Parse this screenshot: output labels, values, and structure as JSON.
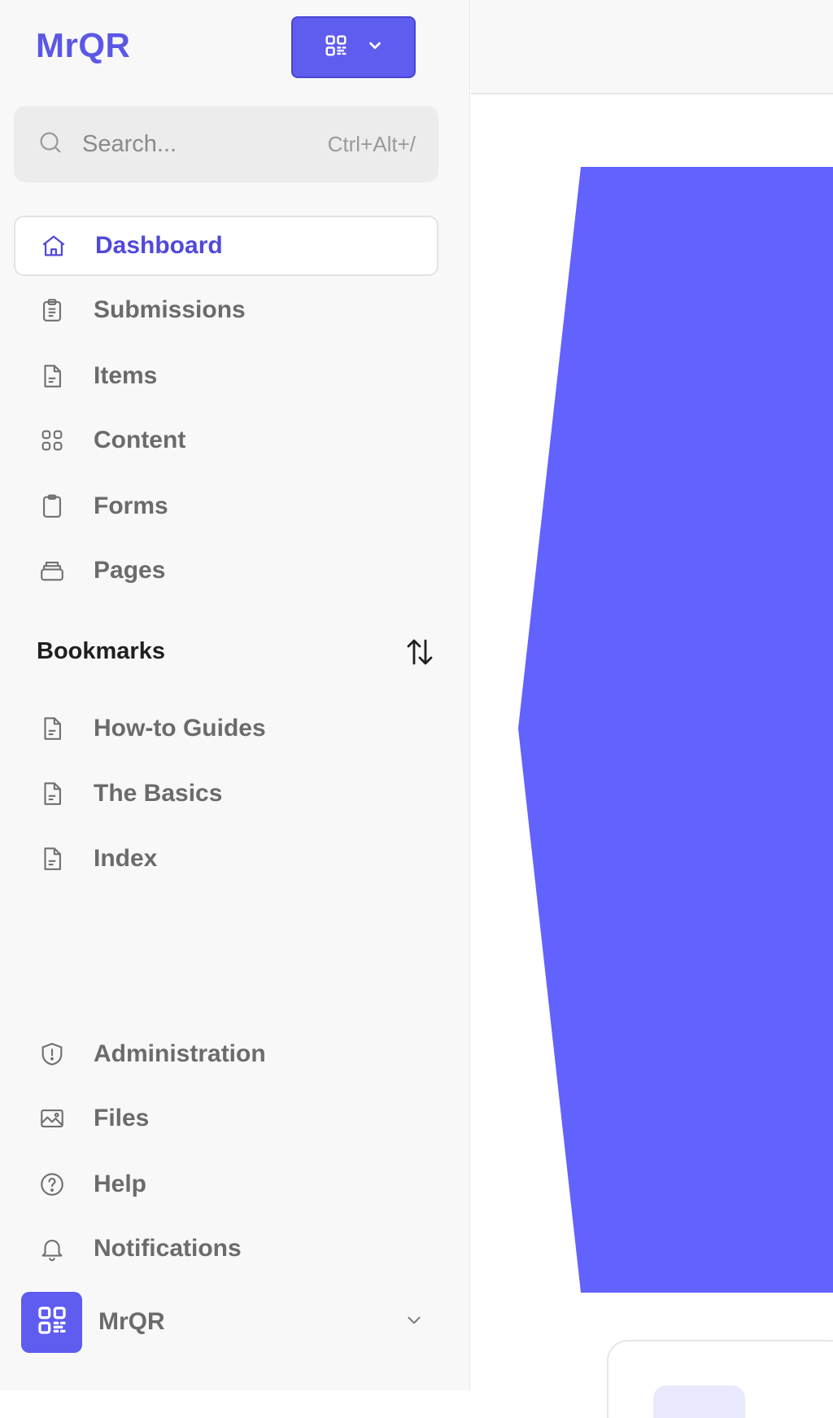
{
  "app": {
    "logo_text": "MrQR"
  },
  "search": {
    "placeholder": "Search...",
    "shortcut": "Ctrl+Alt+/"
  },
  "nav": {
    "items": [
      {
        "label": "Dashboard",
        "icon": "home-icon",
        "active": true
      },
      {
        "label": "Submissions",
        "icon": "clipboard-list-icon"
      },
      {
        "label": "Items",
        "icon": "file-text-icon"
      },
      {
        "label": "Content",
        "icon": "grid-icon"
      },
      {
        "label": "Forms",
        "icon": "clipboard-icon"
      },
      {
        "label": "Pages",
        "icon": "stack-icon"
      }
    ]
  },
  "bookmarks": {
    "title": "Bookmarks",
    "items": [
      {
        "label": "How-to Guides",
        "icon": "file-text-icon"
      },
      {
        "label": "The Basics",
        "icon": "file-text-icon"
      },
      {
        "label": "Index",
        "icon": "file-text-icon"
      }
    ]
  },
  "footer_nav": {
    "items": [
      {
        "label": "Administration",
        "icon": "shield-alert-icon"
      },
      {
        "label": "Files",
        "icon": "image-icon"
      },
      {
        "label": "Help",
        "icon": "help-circle-icon"
      },
      {
        "label": "Notifications",
        "icon": "bell-icon"
      }
    ]
  },
  "account": {
    "name": "MrQR",
    "icon": "qr-code-icon"
  },
  "colors": {
    "accent": "#5f5cf0",
    "accent_text": "#5149d8",
    "hero": "#6262ff"
  }
}
